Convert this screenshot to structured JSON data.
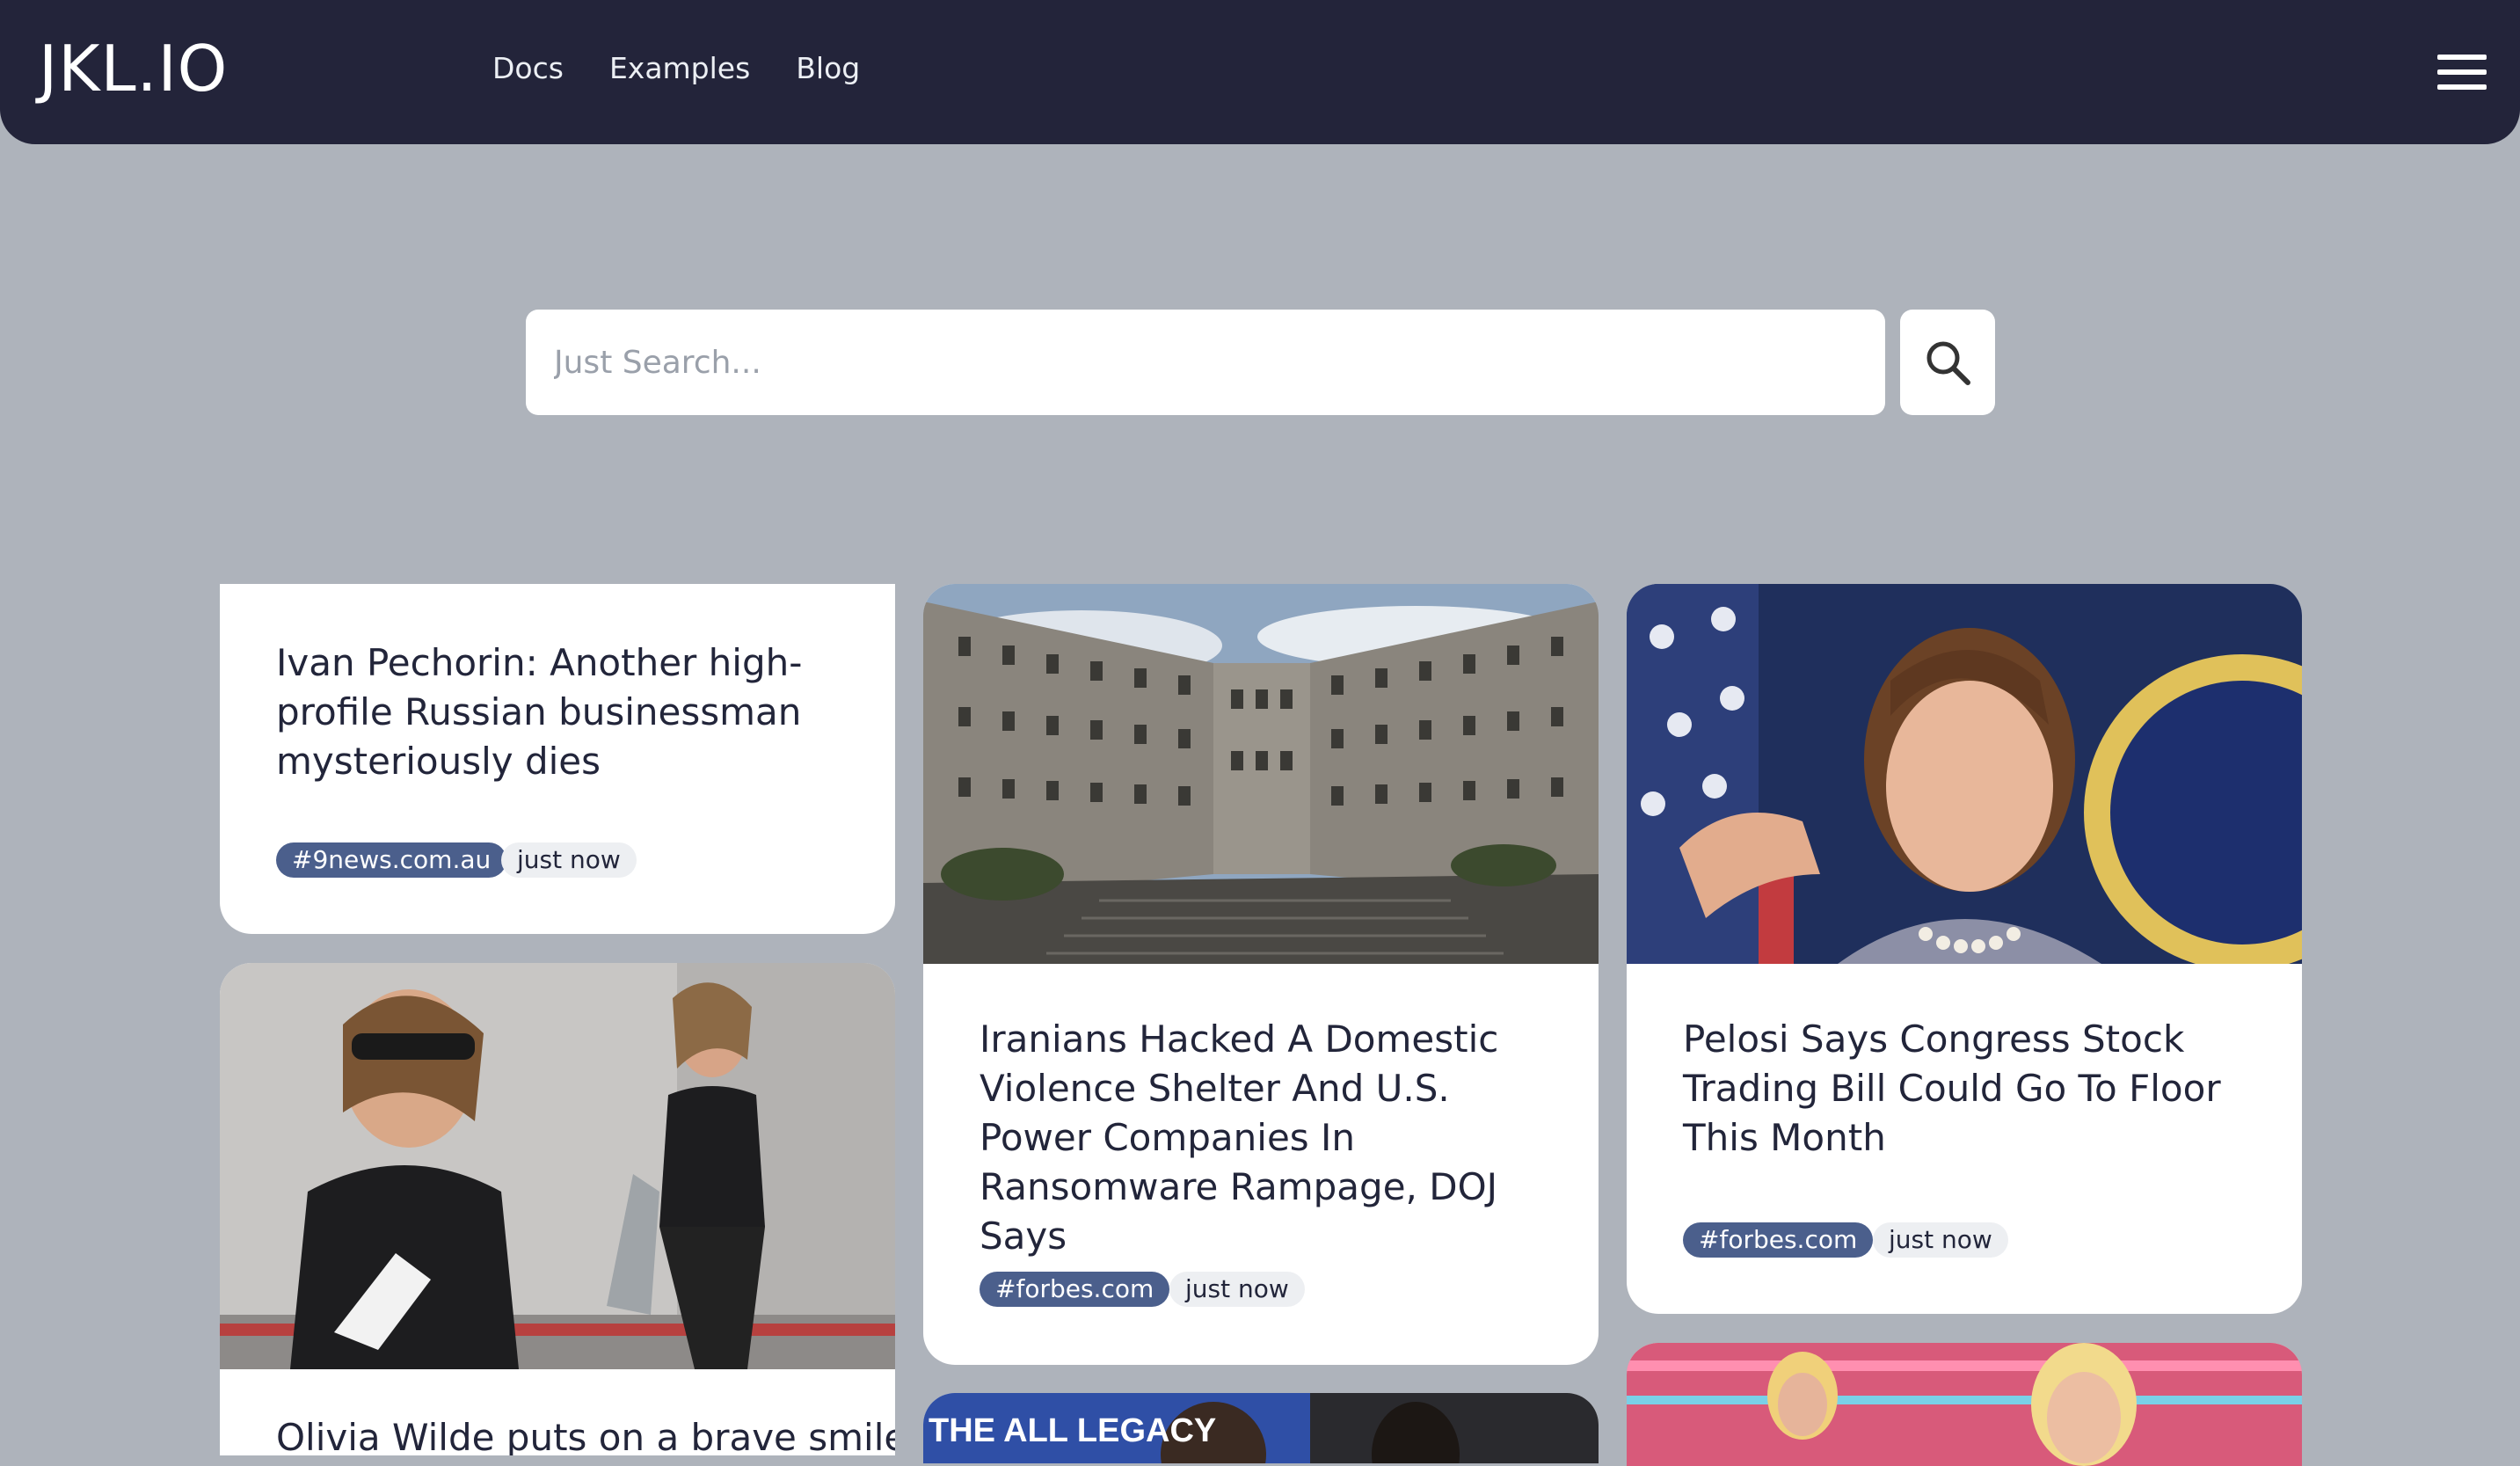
{
  "header": {
    "logo": "JKL.IO",
    "nav": [
      "Docs",
      "Examples",
      "Blog"
    ],
    "menu_icon": "hamburger-icon"
  },
  "search": {
    "placeholder": "Just Search...",
    "button_icon": "search-icon"
  },
  "articles": [
    {
      "title": "Ivan Pechorin: Another high-profile Russian businessman mysteriously dies",
      "source": "#9news.com.au",
      "time": "just now"
    },
    {
      "title": "Iranians Hacked A Domestic Violence Shelter And U.S. Power Companies In Ransomware Rampage, DOJ Says",
      "source": "#forbes.com",
      "time": "just now"
    },
    {
      "title": "Pelosi Says Congress Stock Trading Bill Could Go To Floor This Month",
      "source": "#forbes.com",
      "time": "just now"
    },
    {
      "title": "Olivia Wilde puts on a brave smile"
    },
    {
      "image_text": "THE ALL LEGACY"
    }
  ],
  "colors": {
    "topbar": "#23243a",
    "background": "#aeb3bb",
    "source_tag": "#4b5f8c"
  }
}
